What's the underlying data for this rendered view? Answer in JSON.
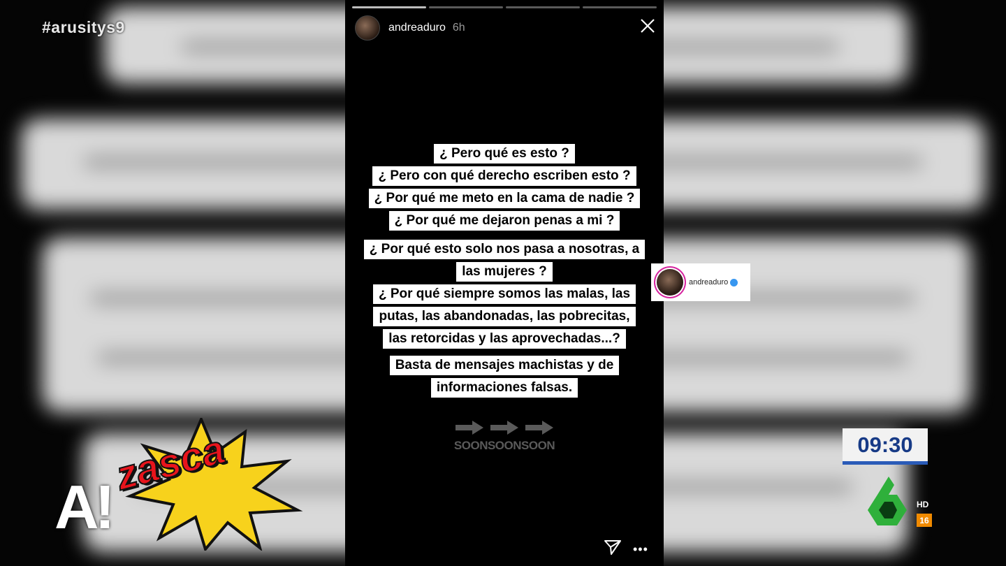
{
  "overlay": {
    "hashtag": "#arusitys9",
    "clock": "09:30",
    "hd_label": "HD",
    "age_rating": "16",
    "show_logo": {
      "a_text": "A!",
      "zasca_text": "zasca"
    }
  },
  "story": {
    "username": "andreaduro",
    "time_ago": "6h",
    "progress_segments": 4,
    "progress_done": 1,
    "paragraph1": [
      "¿ Pero qué es esto ?",
      "¿ Pero con qué derecho escriben esto ?",
      "¿ Por qué me meto en la cama de nadie ?",
      "¿ Por qué me dejaron penas a mi ?"
    ],
    "paragraph2": [
      "¿ Por qué esto solo nos pasa a nosotras, a",
      "las mujeres ?",
      "¿ Por qué siempre somos las malas, las",
      "putas, las abandonadas, las pobrecitas,",
      "las retorcidas y las aprovechadas...?"
    ],
    "paragraph3": [
      "Basta de mensajes machistas y de",
      "informaciones falsas."
    ],
    "soon_text": "SOONSOONSOON",
    "mention_username": "andreaduro",
    "more_label": "•••"
  },
  "colors": {
    "clock_text": "#173a86",
    "clock_bar": "#2a5bb8",
    "logo_red": "#e8141c",
    "burst_yellow": "#f7d21c",
    "la6_green": "#2fb03b"
  }
}
